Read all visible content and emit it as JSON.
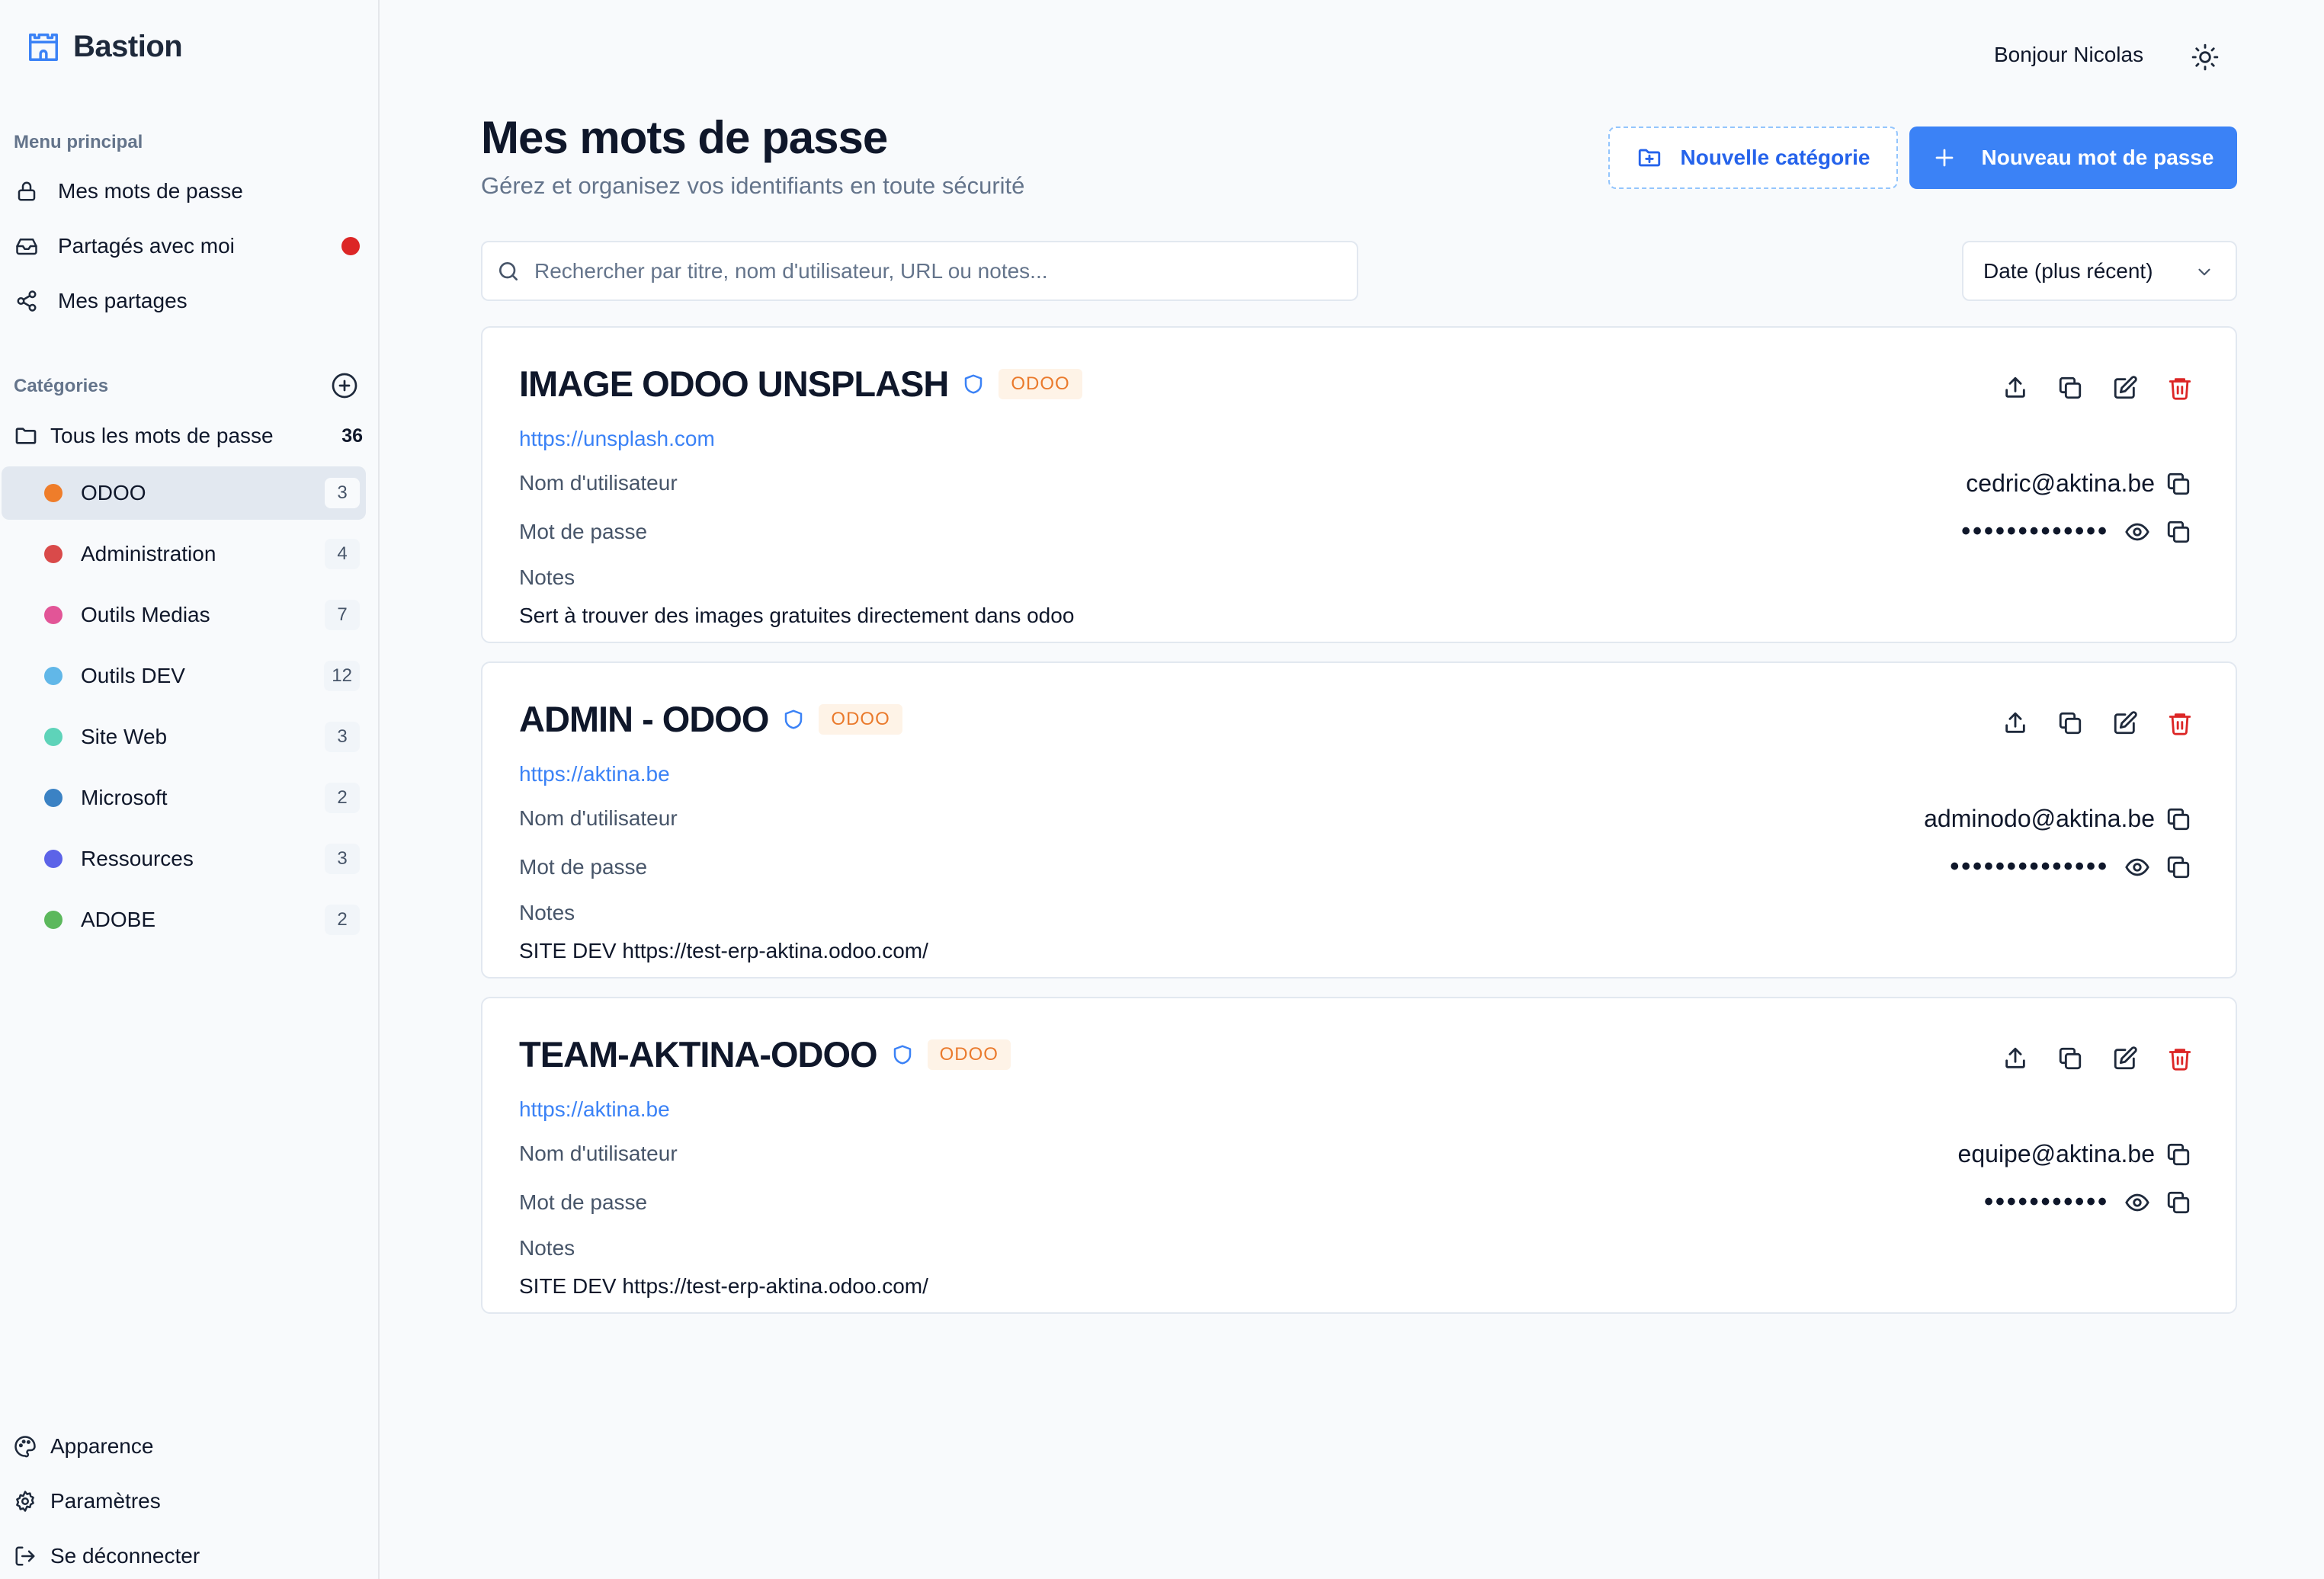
{
  "app": {
    "name": "Bastion",
    "greeting": "Bonjour Nicolas"
  },
  "sidebar": {
    "menu_label": "Menu principal",
    "menu": [
      {
        "label": "Mes mots de passe",
        "icon": "lock-icon"
      },
      {
        "label": "Partagés avec moi",
        "icon": "inbox-icon",
        "notification": true
      },
      {
        "label": "Mes partages",
        "icon": "share-icon"
      }
    ],
    "categories_label": "Catégories",
    "all": {
      "label": "Tous les mots de passe",
      "count": "36"
    },
    "categories": [
      {
        "name": "ODOO",
        "count": "3",
        "color": "#ef7d2a",
        "active": true
      },
      {
        "name": "Administration",
        "count": "4",
        "color": "#d94a4a"
      },
      {
        "name": "Outils Medias",
        "count": "7",
        "color": "#e25597"
      },
      {
        "name": "Outils DEV",
        "count": "12",
        "color": "#61b7e8"
      },
      {
        "name": "Site Web",
        "count": "3",
        "color": "#5ed3b9"
      },
      {
        "name": "Microsoft",
        "count": "2",
        "color": "#3b82c4"
      },
      {
        "name": "Ressources",
        "count": "3",
        "color": "#5c63e8"
      },
      {
        "name": "ADOBE",
        "count": "2",
        "color": "#5cb85c"
      }
    ],
    "bottom": [
      {
        "label": "Apparence",
        "icon": "palette-icon"
      },
      {
        "label": "Paramètres",
        "icon": "settings-icon"
      },
      {
        "label": "Se déconnecter",
        "icon": "logout-icon"
      }
    ]
  },
  "header": {
    "title": "Mes mots de passe",
    "subtitle": "Gérez et organisez vos identifiants en toute sécurité",
    "new_category": "Nouvelle catégorie",
    "new_password": "Nouveau mot de passe"
  },
  "search": {
    "placeholder": "Rechercher par titre, nom d'utilisateur, URL ou notes..."
  },
  "sort": {
    "value": "Date (plus récent)"
  },
  "labels": {
    "username": "Nom d'utilisateur",
    "password": "Mot de passe",
    "notes": "Notes"
  },
  "passwords": [
    {
      "title": "IMAGE ODOO UNSPLASH",
      "category": "ODOO",
      "url": "https://unsplash.com",
      "username": "cedric@aktina.be",
      "masked": "•••••••••••••",
      "notes": "Sert à trouver des images gratuites directement dans odoo"
    },
    {
      "title": "ADMIN - ODOO",
      "category": "ODOO",
      "url": "https://aktina.be",
      "username": "adminodo@aktina.be",
      "masked": "••••••••••••••",
      "notes": "SITE DEV https://test-erp-aktina.odoo.com/"
    },
    {
      "title": "TEAM-AKTINA-ODOO",
      "category": "ODOO",
      "url": "https://aktina.be",
      "username": "equipe@aktina.be",
      "masked": "•••••••••••",
      "notes": "SITE DEV https://test-erp-aktina.odoo.com/"
    }
  ],
  "colors": {
    "accent": "#3b82f6",
    "danger": "#dc2626",
    "badge_text": "#ea7a2c"
  }
}
